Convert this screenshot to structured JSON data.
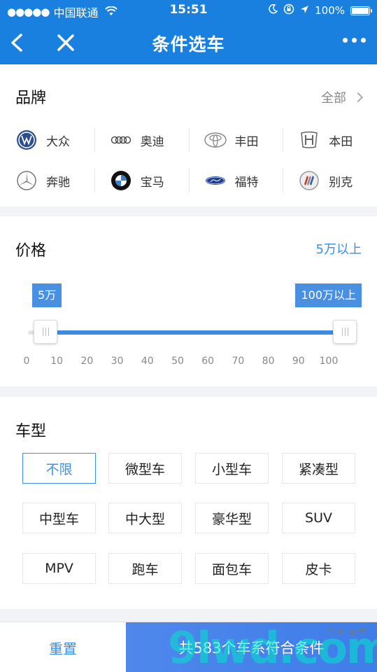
{
  "status": {
    "dots": "●●●●●",
    "carrier": "中国联通",
    "wifi": "wifi-icon",
    "time": "15:51",
    "battery_pct": "100%",
    "icons": [
      "moon-icon",
      "orientation-lock-icon",
      "location-arrow-icon",
      "battery-icon"
    ]
  },
  "nav": {
    "title": "条件选车",
    "back_icon": "back-arrow-icon",
    "close_icon": "close-icon",
    "more_icon": "more-dots-icon"
  },
  "brand": {
    "title": "品牌",
    "all_label": "全部",
    "items": [
      {
        "name": "大众",
        "icon": "volkswagen-logo-icon"
      },
      {
        "name": "奥迪",
        "icon": "audi-logo-icon"
      },
      {
        "name": "丰田",
        "icon": "toyota-logo-icon"
      },
      {
        "name": "本田",
        "icon": "honda-logo-icon"
      },
      {
        "name": "奔驰",
        "icon": "mercedes-logo-icon"
      },
      {
        "name": "宝马",
        "icon": "bmw-logo-icon"
      },
      {
        "name": "福特",
        "icon": "ford-logo-icon"
      },
      {
        "name": "别克",
        "icon": "buick-logo-icon"
      }
    ]
  },
  "price": {
    "title": "价格",
    "range_value": "5万以上",
    "min_tag": "5万",
    "max_tag": "100万以上",
    "slider_min": 5,
    "slider_max": 100,
    "ticks": [
      "0",
      "10",
      "20",
      "30",
      "40",
      "50",
      "60",
      "70",
      "80",
      "90",
      "100"
    ]
  },
  "car_type": {
    "title": "车型",
    "options": [
      "不限",
      "微型车",
      "小型车",
      "紧凑型",
      "中型车",
      "中大型",
      "豪华型",
      "SUV",
      "MPV",
      "跑车",
      "面包车",
      "皮卡"
    ],
    "selected": "不限"
  },
  "bottom": {
    "reset_label": "重置",
    "submit_label": "共583个车系符合条件"
  },
  "watermark": {
    "text": "9lwd.com",
    "sub": "纯净 图库"
  },
  "colors": {
    "primary": "#1a80e0",
    "accent": "#3d8fe8"
  }
}
